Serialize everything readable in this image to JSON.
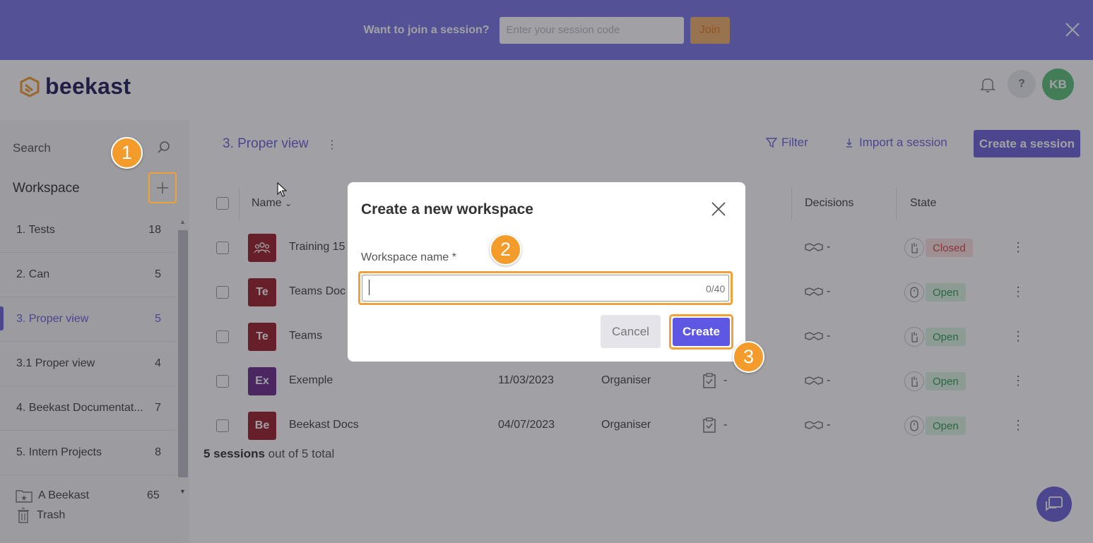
{
  "banner": {
    "text": "Want to join a session?",
    "input_placeholder": "Enter your session code",
    "join_label": "Join"
  },
  "header": {
    "logo_text": "beekast",
    "help_label": "?",
    "avatar_initials": "KB"
  },
  "sidebar": {
    "search_label": "Search",
    "workspace_title": "Workspace",
    "items": [
      {
        "label": "1. Tests",
        "count": "18"
      },
      {
        "label": "2. Can",
        "count": "5"
      },
      {
        "label": "3. Proper view",
        "count": "5"
      },
      {
        "label": "3.1 Proper view",
        "count": "4"
      },
      {
        "label": "4. Beekast Documentat...",
        "count": "7"
      },
      {
        "label": "5. Intern Projects",
        "count": "8"
      }
    ],
    "active_index": 2,
    "shared": {
      "label": "A Beekast",
      "count": "65"
    },
    "trash": {
      "label": "Trash"
    }
  },
  "main": {
    "title": "3. Proper view",
    "filter_label": "Filter",
    "import_label": "Import a session",
    "create_label": "Create a session",
    "columns": {
      "name": "Name",
      "decisions": "Decisions",
      "state": "State"
    },
    "rows": [
      {
        "initials": "",
        "name": "Training 15",
        "date": "",
        "role": "",
        "decision": "-",
        "state": "Closed",
        "color": "#9c1f2c"
      },
      {
        "initials": "Te",
        "name": "Teams Doc",
        "date": "",
        "role": "",
        "decision": "-",
        "state": "Open",
        "color": "#9c1f2c"
      },
      {
        "initials": "Te",
        "name": "Teams",
        "date": "",
        "role": "",
        "decision": "-",
        "state": "Open",
        "color": "#9c1f2c"
      },
      {
        "initials": "Ex",
        "name": "Exemple",
        "date": "11/03/2023",
        "role": "Organiser",
        "task": "-",
        "decision": "-",
        "state": "Open",
        "color": "#6a2e8a"
      },
      {
        "initials": "Be",
        "name": "Beekast Docs",
        "date": "04/07/2023",
        "role": "Organiser",
        "task": "-",
        "decision": "-",
        "state": "Open",
        "color": "#9c1f2c"
      }
    ],
    "summary_bold": "5 sessions",
    "summary_rest": " out of 5 total"
  },
  "modal": {
    "title": "Create a new workspace",
    "field_label": "Workspace name *",
    "field_value": "",
    "char_count": "0/40",
    "cancel_label": "Cancel",
    "create_label": "Create"
  },
  "steps": [
    "1",
    "2",
    "3"
  ],
  "colors": {
    "accent": "#6c63d8",
    "banner": "#7b78e6",
    "highlight": "#f0a23a",
    "open": "#2f9c55",
    "closed": "#d04545"
  }
}
